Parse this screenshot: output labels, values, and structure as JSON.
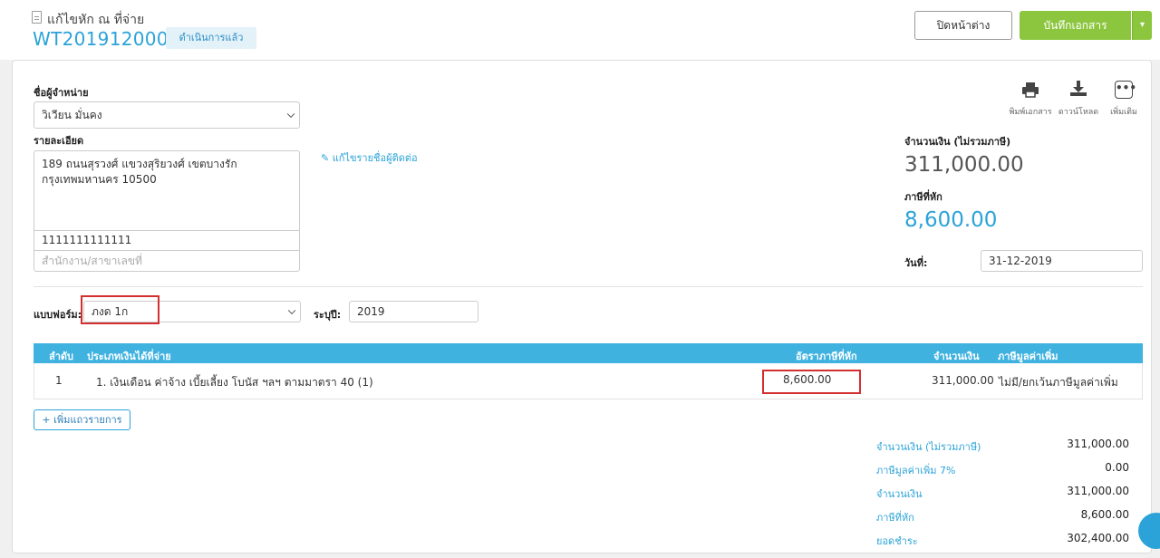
{
  "header": {
    "title": "แก้ไขหัก ณ ที่จ่าย",
    "doc_number": "WT2019120001",
    "status": "ดำเนินการแล้ว",
    "close_label": "ปิดหน้าต่าง",
    "save_label": "บันทึกเอกสาร"
  },
  "vendor": {
    "name_label": "ชื่อผู้จำหน่าย",
    "name_value": "วิเวียน มั่นคง",
    "details_label": "รายละเอียด",
    "address": "189 ถนนสุรวงศ์ แขวงสุริยวงศ์ เขตบางรัก กรุงเทพมหานคร 10500",
    "tax_id": "1111111111111",
    "branch_placeholder": "สำนักงาน/สาขาเลขที่",
    "edit_link": "แก้ไขรายชื่อผู้ติดต่อ"
  },
  "actions": {
    "print_label": "พิมพ์เอกสาร",
    "download_label": "ดาวน์โหลด",
    "more_label": "เพิ่มเติม"
  },
  "summary_top": {
    "amount_label": "จำนวนเงิน (ไม่รวมภาษี)",
    "amount_value": "311,000.00",
    "tax_label": "ภาษีที่หัก",
    "tax_value": "8,600.00",
    "date_label": "วันที่:",
    "date_value": "31-12-2019"
  },
  "form": {
    "form_label": "แบบฟอร์ม:",
    "form_value": "ภงด 1ก",
    "year_label": "ระบุปี:",
    "year_value": "2019"
  },
  "table": {
    "headers": [
      "ลำดับ",
      "ประเภทเงินได้ที่จ่าย",
      "อัตราภาษีที่หัก",
      "จำนวนเงิน",
      "ภาษีมูลค่าเพิ่ม"
    ],
    "rows": [
      {
        "index": "1",
        "type": "1. เงินเดือน ค่าจ้าง เบี้ยเลี้ยง โบนัส ฯลฯ ตามมาตรา 40 (1)",
        "tax": "8,600.00",
        "amount": "311,000.00",
        "vat": "ไม่มี/ยกเว้นภาษีมูลค่าเพิ่ม"
      }
    ],
    "add_row_label": "+ เพิ่มแถวรายการ"
  },
  "totals": [
    {
      "label": "จำนวนเงิน (ไม่รวมภาษี)",
      "value": "311,000.00"
    },
    {
      "label": "ภาษีมูลค่าเพิ่ม 7%",
      "value": "0.00"
    },
    {
      "label": "จำนวนเงิน",
      "value": "311,000.00"
    },
    {
      "label": "ภาษีที่หัก",
      "value": "8,600.00"
    },
    {
      "label": "ยอดชำระ",
      "value": "302,400.00"
    }
  ],
  "colors": {
    "accent": "#2ba3d8",
    "save_green": "#8cc63f",
    "table_header": "#3fb2e0",
    "highlight_red": "#d32f2f"
  }
}
